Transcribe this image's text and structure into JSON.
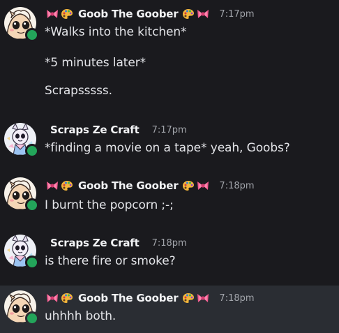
{
  "messages": [
    {
      "username": "Goob The Goober",
      "timestamp": "7:17pm",
      "lines": [
        "*Walks into the kitchen*",
        "*5 minutes later*",
        "Scrapsssss."
      ]
    },
    {
      "username": "Scraps Ze Craft",
      "timestamp": "7:17pm",
      "lines": [
        "*finding a movie on a tape* yeah, Goobs?"
      ]
    },
    {
      "username": "Goob The Goober",
      "timestamp": "7:18pm",
      "lines": [
        "I burnt the popcorn ;-;"
      ]
    },
    {
      "username": "Scraps Ze Craft",
      "timestamp": "7:18pm",
      "lines": [
        "is there fire or smoke?"
      ]
    },
    {
      "username": "Goob The Goober",
      "timestamp": "7:18pm",
      "lines": [
        "uhhhh both."
      ]
    }
  ],
  "icons": {
    "name_decoration_left": [
      "ribbon-icon",
      "palette-icon"
    ],
    "name_decoration_right": [
      "palette-icon",
      "ribbon-icon"
    ],
    "status": "online-status-icon"
  },
  "colors": {
    "background": "#1a1a1e",
    "highlight_background": "#2a2d33",
    "online": "#23a55a",
    "username": "#f2f3f5",
    "timestamp": "#a2a5ab"
  }
}
